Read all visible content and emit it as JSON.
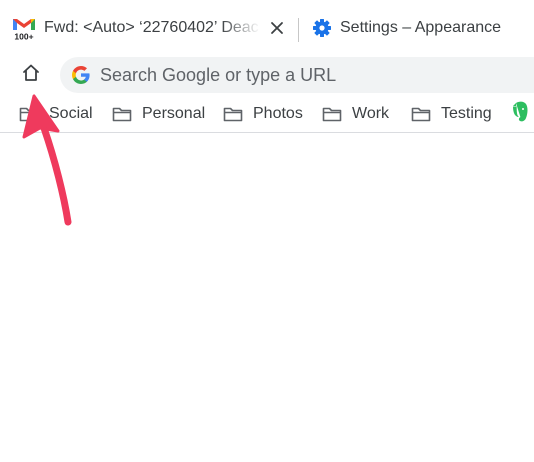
{
  "tabs": [
    {
      "title": "Fwd: <Auto> ‘22760402’ Deac",
      "favicon": "gmail-icon",
      "badge": "100+",
      "close_icon": "close-icon"
    },
    {
      "title": "Settings – Appearance",
      "favicon": "settings-gear-icon"
    }
  ],
  "toolbar": {
    "home_icon": "home-icon",
    "omnibox": {
      "placeholder": "Search Google or type a URL",
      "value": "",
      "icon": "google-g-icon"
    }
  },
  "bookmarks": [
    {
      "label": "Social",
      "icon": "folder-icon"
    },
    {
      "label": "Personal",
      "icon": "folder-icon"
    },
    {
      "label": "Photos",
      "icon": "folder-icon"
    },
    {
      "label": "Work",
      "icon": "folder-icon"
    },
    {
      "label": "Testing",
      "icon": "folder-icon"
    },
    {
      "label": "",
      "icon": "evernote-icon"
    }
  ],
  "annotation": {
    "type": "arrow",
    "color": "#ef3a5d",
    "points_to": "home-button"
  },
  "colors": {
    "tab_text": "#3c4043",
    "omnibox_bg": "#f1f3f4",
    "settings_icon": "#1a73e8",
    "evernote_green": "#2dbe60",
    "arrow": "#ef3a5d"
  }
}
